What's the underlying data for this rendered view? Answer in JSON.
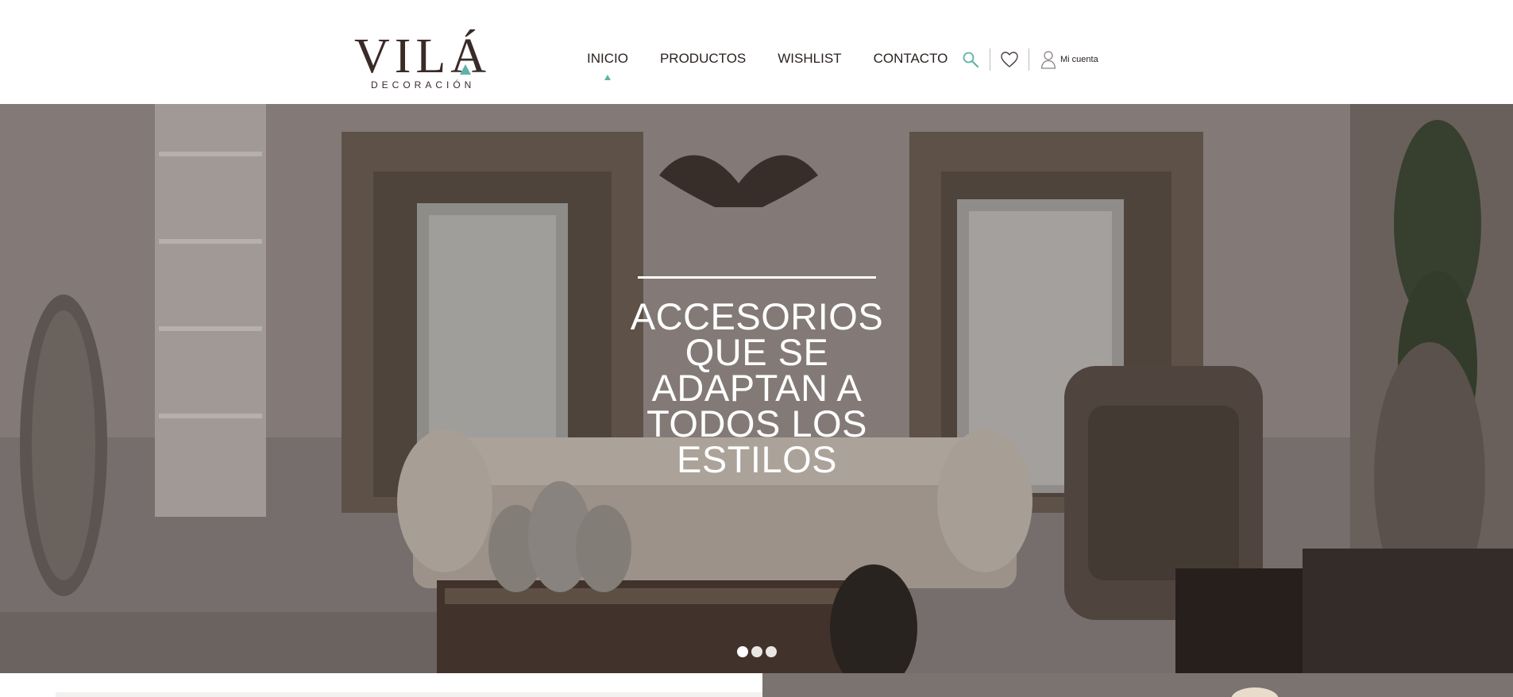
{
  "brand": {
    "name": "VILÁ",
    "subtitle": "DECORACIÓN",
    "accent_color": "#5fb2a8"
  },
  "nav": {
    "items": [
      {
        "label": "INICIO",
        "active": true
      },
      {
        "label": "PRODUCTOS",
        "active": false
      },
      {
        "label": "WISHLIST",
        "active": false
      },
      {
        "label": "CONTACTO",
        "active": false
      }
    ]
  },
  "tools": {
    "search_icon": "search-icon",
    "wishlist_icon": "heart-icon",
    "account_icon": "user-icon",
    "account_label": "Mi cuenta"
  },
  "hero": {
    "title": "ACCESORIOS QUE SE ADAPTAN A TODOS LOS ESTILOS",
    "slides_total": 3,
    "active_slide": 1
  }
}
